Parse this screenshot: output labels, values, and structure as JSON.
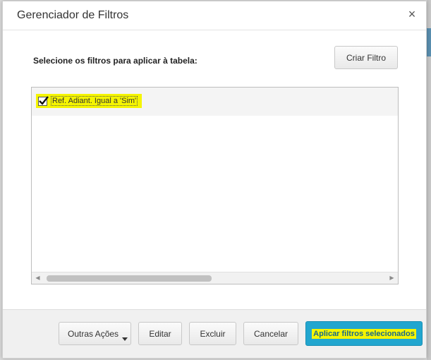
{
  "dialog": {
    "title": "Gerenciador de Filtros",
    "close_symbol": "×",
    "instruction": "Selecione os filtros para aplicar à tabela:",
    "create_filter_label": "Criar Filtro"
  },
  "filters": [
    {
      "label": "Ref. Adiant. Igual a 'Sim'",
      "checked": true
    }
  ],
  "footer": {
    "more_actions_label": "Outras Ações",
    "edit_label": "Editar",
    "delete_label": "Excluir",
    "cancel_label": "Cancelar",
    "apply_label": "Aplicar filtros selecionados"
  },
  "colors": {
    "highlight": "#f5f500",
    "primary_button": "#22a6cf"
  },
  "icons": {
    "close": "close-icon",
    "checkbox_check": "check-icon",
    "dropdown": "caret-down-icon",
    "scroll_left": "arrow-left-icon",
    "scroll_right": "arrow-right-icon"
  }
}
